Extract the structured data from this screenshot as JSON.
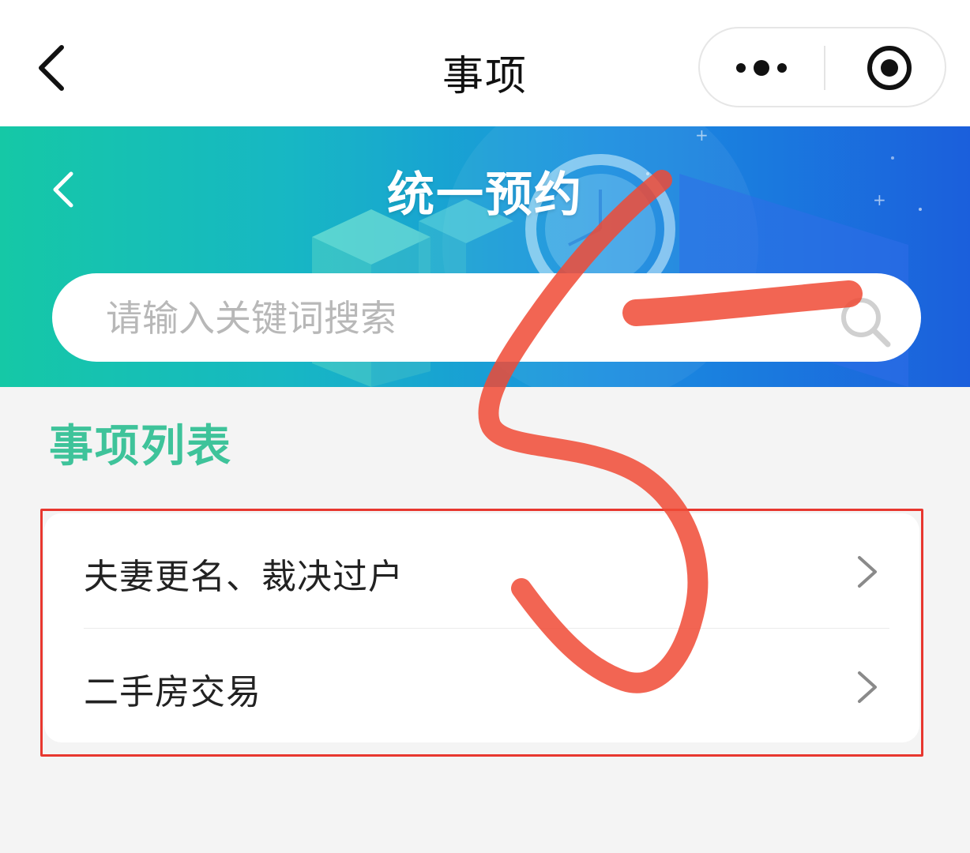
{
  "navbar": {
    "title": "事项"
  },
  "banner": {
    "title": "统一预约"
  },
  "search": {
    "placeholder": "请输入关键词搜索"
  },
  "section": {
    "title": "事项列表"
  },
  "list": {
    "items": [
      {
        "label": "夫妻更名、裁决过户"
      },
      {
        "label": "二手房交易"
      }
    ]
  },
  "colors": {
    "accent_green": "#3ec39a",
    "banner_start": "#15c8a6",
    "banner_end": "#1b5fdc",
    "annotation_red": "#f04a35"
  },
  "icons": {
    "nav_back": "chevron-left-icon",
    "capsule_more": "more-dots-icon",
    "capsule_close": "target-circle-icon",
    "banner_back": "chevron-left-icon",
    "search": "search-icon",
    "item_arrow": "chevron-right-icon"
  }
}
